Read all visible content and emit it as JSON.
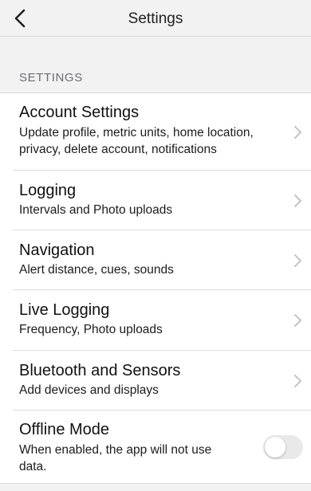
{
  "nav": {
    "title": "Settings"
  },
  "section_header": "SETTINGS",
  "items": [
    {
      "title": "Account Settings",
      "subtitle": "Update profile, metric units, home location, privacy, delete account, notifications",
      "accessory": "chevron-right-icon"
    },
    {
      "title": "Logging",
      "subtitle": "Intervals and Photo uploads",
      "accessory": "chevron-right-icon"
    },
    {
      "title": "Navigation",
      "subtitle": "Alert distance, cues, sounds",
      "accessory": "chevron-right-icon"
    },
    {
      "title": "Live Logging",
      "subtitle": "Frequency, Photo uploads",
      "accessory": "chevron-right-icon"
    },
    {
      "title": "Bluetooth and Sensors",
      "subtitle": "Add devices and displays",
      "accessory": "chevron-right-icon"
    },
    {
      "title": "Offline Mode",
      "subtitle": "When enabled, the app will not use data.",
      "accessory": "toggle",
      "toggle_on": false
    }
  ],
  "colors": {
    "background": "#f2f2f2",
    "cell": "#ffffff",
    "toggle_off": "#e9e9ea",
    "chevron": "#c4c4c7",
    "secondary_text": "#6d6d72"
  }
}
